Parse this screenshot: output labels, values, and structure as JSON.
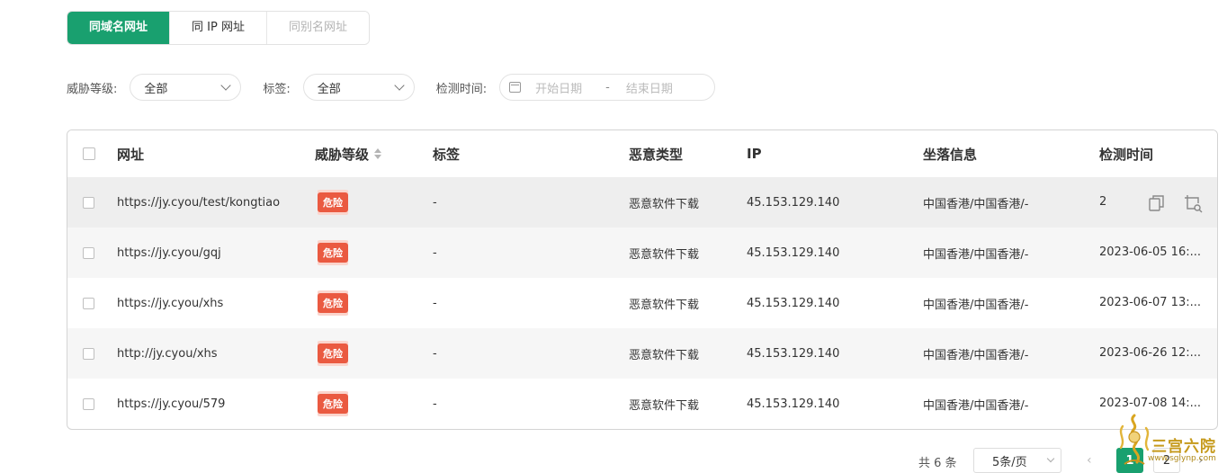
{
  "tabs": [
    {
      "label": "同域名网址",
      "active": true
    },
    {
      "label": "同 IP 网址",
      "active": false
    },
    {
      "label": "同别名网址",
      "active": false
    }
  ],
  "filters": {
    "threat_label": "威胁等级:",
    "threat_value": "全部",
    "tag_label": "标签:",
    "tag_value": "全部",
    "time_label": "检测时间:",
    "start_placeholder": "开始日期",
    "separator": "-",
    "end_placeholder": "结束日期"
  },
  "table": {
    "columns": [
      "网址",
      "威胁等级",
      "标签",
      "恶意类型",
      "IP",
      "坐落信息",
      "检测时间"
    ],
    "rows": [
      {
        "url": "https://jy.cyou/test/kongtiao",
        "level": "危险",
        "tag": "-",
        "type": "恶意软件下载",
        "ip": "45.153.129.140",
        "location": "中国香港/中国香港/-",
        "time": "2"
      },
      {
        "url": "https://jy.cyou/gqj",
        "level": "危险",
        "tag": "-",
        "type": "恶意软件下载",
        "ip": "45.153.129.140",
        "location": "中国香港/中国香港/-",
        "time": "2023-06-05 16:..."
      },
      {
        "url": "https://jy.cyou/xhs",
        "level": "危险",
        "tag": "-",
        "type": "恶意软件下载",
        "ip": "45.153.129.140",
        "location": "中国香港/中国香港/-",
        "time": "2023-06-07 13:..."
      },
      {
        "url": "http://jy.cyou/xhs",
        "level": "危险",
        "tag": "-",
        "type": "恶意软件下载",
        "ip": "45.153.129.140",
        "location": "中国香港/中国香港/-",
        "time": "2023-06-26 12:..."
      },
      {
        "url": "https://jy.cyou/579",
        "level": "危险",
        "tag": "-",
        "type": "恶意软件下载",
        "ip": "45.153.129.140",
        "location": "中国香港/中国香港/-",
        "time": "2023-07-08 14:..."
      }
    ],
    "row_actions": [
      "copy-icon",
      "screenshot-search-icon"
    ]
  },
  "pagination": {
    "total": "共 6 条",
    "page_size": "5条/页",
    "prev": "‹",
    "pages": [
      "1",
      "2"
    ],
    "current": "1",
    "next": "›"
  },
  "watermark": {
    "text": "三宫六院",
    "url": "www.sglynp.com"
  },
  "colors": {
    "brand_green": "#19a06f",
    "danger_red": "#ea5a41"
  }
}
